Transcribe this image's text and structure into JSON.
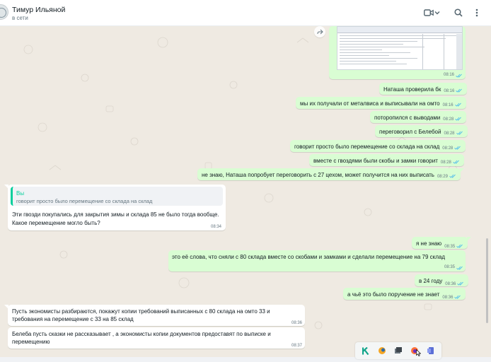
{
  "header": {
    "contact_name": "Тимур Ильяной",
    "status": "в сети"
  },
  "icons": {
    "video": "video-call-icon",
    "dropdown": "chevron-down-icon",
    "search": "search-icon",
    "menu": "kebab-menu-icon",
    "forward": "forward-icon",
    "read": "double-check-icon",
    "pointer": "mouse-pointer-icon"
  },
  "colors": {
    "outgoing_bubble": "#d9fdd3",
    "incoming_bubble": "#ffffff",
    "chat_background": "#efeae2",
    "read_check": "#53bdeb",
    "quote_accent": "#06cf9c"
  },
  "messages": {
    "m0": {
      "time": "08:16"
    },
    "m1": {
      "text": "Наташа проверила бк",
      "time": "08:16"
    },
    "m2": {
      "text": "мы их получали от металвиса и выписывали на омто",
      "time": "08:16"
    },
    "m3": {
      "text": "поторопился с выводами",
      "time": "08:28"
    },
    "m4": {
      "text": "переговорил с Белебой",
      "time": "08:28"
    },
    "m5": {
      "text": "говорит просто было перемещение со склада на склад",
      "time": "08:28"
    },
    "m6": {
      "text": "вместе с гвоздями были скобы и замки говорит",
      "time": "08:28"
    },
    "m7": {
      "text": "не знаю, Наташа  попробует переговорить с 27 цехом, может получится на них выписать",
      "time": "08:29"
    },
    "m8": {
      "quote_author": "Вы",
      "quote_text": "говорит просто было перемещение со склада на склад",
      "line1": "Эти гвозди покупались для закрытия зимы и склада 85 не было тогда вообще.",
      "line2": "Какое перемещение могло быть?",
      "time": "08:34"
    },
    "m9": {
      "text": "я не знаю",
      "time": "08:35"
    },
    "m10": {
      "text": "это её слова, что сняли с 80 склада вместе со скобами и замками и сделали перемещение на 79 склад",
      "time": "08:35"
    },
    "m11": {
      "text": "в 24 году",
      "time": "08:36"
    },
    "m12": {
      "text": "а чьё это было поручение не знает",
      "time": "08:36"
    },
    "m13": {
      "line1": "Пусть экономисты разбираются, покажут копии требований выписанных с 80 склада на омто 33 и",
      "line2": "требования на перемещение с 33 на 85 склад",
      "time": "08:36"
    },
    "m14": {
      "line1": "Белеба пусть сказки не рассказывает , а экономисты копии документов предоставят по выписке и",
      "line2": "перемещению",
      "time": "08:37"
    }
  },
  "taskbar": {
    "apps": [
      "taskbar-app-k-icon",
      "taskbar-app-orange-icon",
      "taskbar-app-gray-icon",
      "taskbar-app-firefox-icon",
      "taskbar-app-blue-icon"
    ]
  }
}
